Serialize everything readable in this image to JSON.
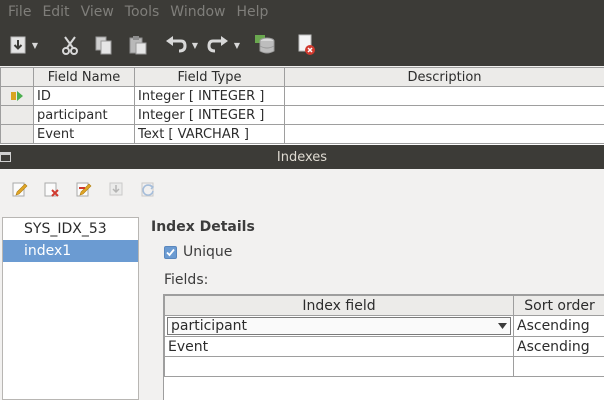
{
  "menu": [
    "File",
    "Edit",
    "View",
    "Tools",
    "Window",
    "Help"
  ],
  "toolbar_icons": [
    "save-icon",
    "cut-icon",
    "copy-icon",
    "paste-icon",
    "undo-icon",
    "redo-icon",
    "database-icon",
    "close-document-icon"
  ],
  "field_table": {
    "headers": [
      "Field Name",
      "Field Type",
      "Description"
    ],
    "rows": [
      {
        "name": "ID",
        "type": "Integer [ INTEGER ]",
        "description": "",
        "primary_key": true
      },
      {
        "name": "participant",
        "type": "Integer [ INTEGER ]",
        "description": "",
        "primary_key": false
      },
      {
        "name": "Event",
        "type": "Text [ VARCHAR ]",
        "description": "",
        "primary_key": false
      }
    ]
  },
  "dialog": {
    "title": "Indexes",
    "index_toolbar_icons": [
      "new-index-icon",
      "delete-index-icon",
      "rename-index-icon",
      "save-index-icon",
      "reset-index-icon"
    ],
    "indexes": [
      {
        "label": "SYS_IDX_53",
        "selected": false
      },
      {
        "label": "index1",
        "selected": true
      }
    ],
    "details_heading": "Index Details",
    "unique_label": "Unique",
    "unique_checked": true,
    "fields_label": "Fields:",
    "grid": {
      "headers": [
        "Index field",
        "Sort order"
      ],
      "rows": [
        {
          "field": "participant",
          "sort": "Ascending",
          "editing": true
        },
        {
          "field": "Event",
          "sort": "Ascending",
          "editing": false
        },
        {
          "field": "",
          "sort": "",
          "editing": false
        }
      ]
    }
  },
  "colors": {
    "chrome_dark": "#3c3b37",
    "selection": "#6b9bd2",
    "panel": "#f2f1f0"
  }
}
